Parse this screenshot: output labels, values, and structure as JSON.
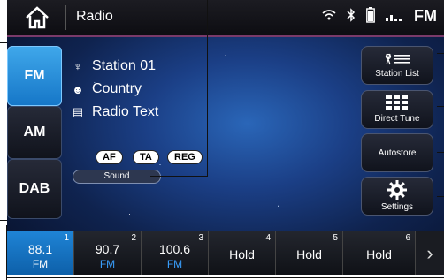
{
  "header": {
    "title": "Radio",
    "corner_text": "FM"
  },
  "bands": [
    {
      "label": "FM"
    },
    {
      "label": "AM"
    },
    {
      "label": "DAB"
    }
  ],
  "station": {
    "name": "Station 01",
    "genre": "Country",
    "radio_text": "Radio Text"
  },
  "tags": {
    "af": "AF",
    "ta": "TA",
    "reg": "REG",
    "sound": "Sound"
  },
  "side_buttons": {
    "station_list": "Station List",
    "direct_tune": "Direct Tune",
    "autostore": "Autostore",
    "settings": "Settings"
  },
  "presets": [
    {
      "num": "1",
      "freq": "88.1",
      "band": "FM"
    },
    {
      "num": "2",
      "freq": "90.7",
      "band": "FM"
    },
    {
      "num": "3",
      "freq": "100.6",
      "band": "FM"
    },
    {
      "num": "4",
      "freq": "Hold",
      "band": ""
    },
    {
      "num": "5",
      "freq": "Hold",
      "band": ""
    },
    {
      "num": "6",
      "freq": "Hold",
      "band": ""
    }
  ],
  "colors": {
    "accent": "#1f84d6",
    "header_divider": "#7a3a6a"
  }
}
